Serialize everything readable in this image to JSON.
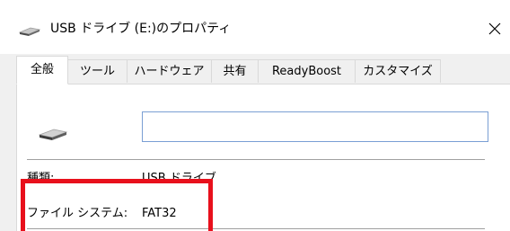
{
  "window": {
    "title": "USB ドライブ (E:)のプロパティ",
    "title_icon": "usb-drive-icon",
    "close_icon": "close-icon"
  },
  "tabs": [
    {
      "label": "全般",
      "active": true
    },
    {
      "label": "ツール",
      "active": false
    },
    {
      "label": "ハードウェア",
      "active": false
    },
    {
      "label": "共有",
      "active": false
    },
    {
      "label": "ReadyBoost",
      "active": false
    },
    {
      "label": "カスタマイズ",
      "active": false
    }
  ],
  "general": {
    "drive_icon": "usb-drive-icon",
    "volume_name": "",
    "type_label": "種類:",
    "type_value": "USB ドライブ",
    "filesystem_label": "ファイル システム:",
    "filesystem_value": "FAT32"
  },
  "colors": {
    "highlight": "#e8101c",
    "input_border": "#7a9fd4",
    "tab_background": "#f0f0f0"
  }
}
